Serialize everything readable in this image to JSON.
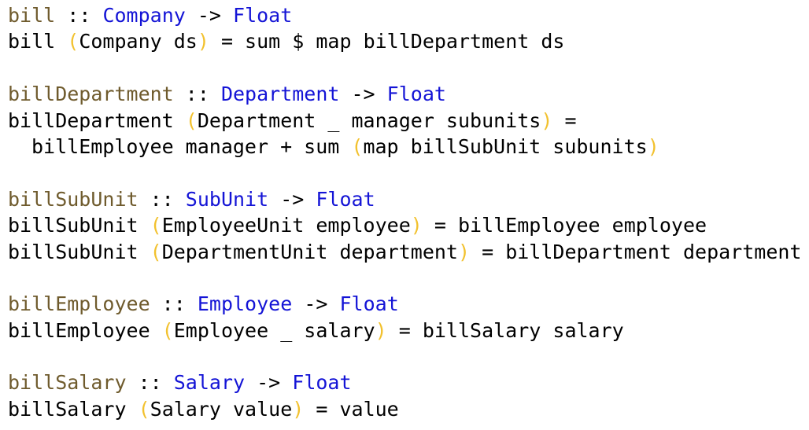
{
  "code": {
    "bill": {
      "sig_name": "bill",
      "sig_sep": " :: ",
      "sig_arg": "Company",
      "sig_arrow": " -> ",
      "sig_ret": "Float",
      "def_head": "bill ",
      "def_open": "(",
      "def_pattern": "Company ds",
      "def_close": ")",
      "def_body": " = sum $ map billDepartment ds"
    },
    "billDepartment": {
      "sig_name": "billDepartment",
      "sig_sep": " :: ",
      "sig_arg": "Department",
      "sig_arrow": " -> ",
      "sig_ret": "Float",
      "def_head": "billDepartment ",
      "def_open": "(",
      "def_pattern": "Department _ manager subunits",
      "def_close": ")",
      "def_body": " =",
      "cont_pre": "billEmployee manager + sum ",
      "cont_open": "(",
      "cont_expr": "map billSubUnit subunits",
      "cont_close": ")"
    },
    "billSubUnit": {
      "sig_name": "billSubUnit",
      "sig_sep": " :: ",
      "sig_arg": "SubUnit",
      "sig_arrow": " -> ",
      "sig_ret": "Float",
      "def1_head": "billSubUnit ",
      "def1_open": "(",
      "def1_pattern": "EmployeeUnit employee",
      "def1_close": ")",
      "def1_body": " = billEmployee employee",
      "def2_head": "billSubUnit ",
      "def2_open": "(",
      "def2_pattern": "DepartmentUnit department",
      "def2_close": ")",
      "def2_body": " = billDepartment department"
    },
    "billEmployee": {
      "sig_name": "billEmployee",
      "sig_sep": " :: ",
      "sig_arg": "Employee",
      "sig_arrow": " -> ",
      "sig_ret": "Float",
      "def_head": "billEmployee ",
      "def_open": "(",
      "def_pattern": "Employee _ salary",
      "def_close": ")",
      "def_body": " = billSalary salary"
    },
    "billSalary": {
      "sig_name": "billSalary",
      "sig_sep": " :: ",
      "sig_arg": "Salary",
      "sig_arrow": " -> ",
      "sig_ret": "Float",
      "def_head": "billSalary ",
      "def_open": "(",
      "def_pattern": "Salary value",
      "def_close": ")",
      "def_body": " = value"
    }
  },
  "colors": {
    "signature_name": "#6f5b2d",
    "type": "#1414d6",
    "paren": "#f2c12e",
    "text": "#000000"
  }
}
